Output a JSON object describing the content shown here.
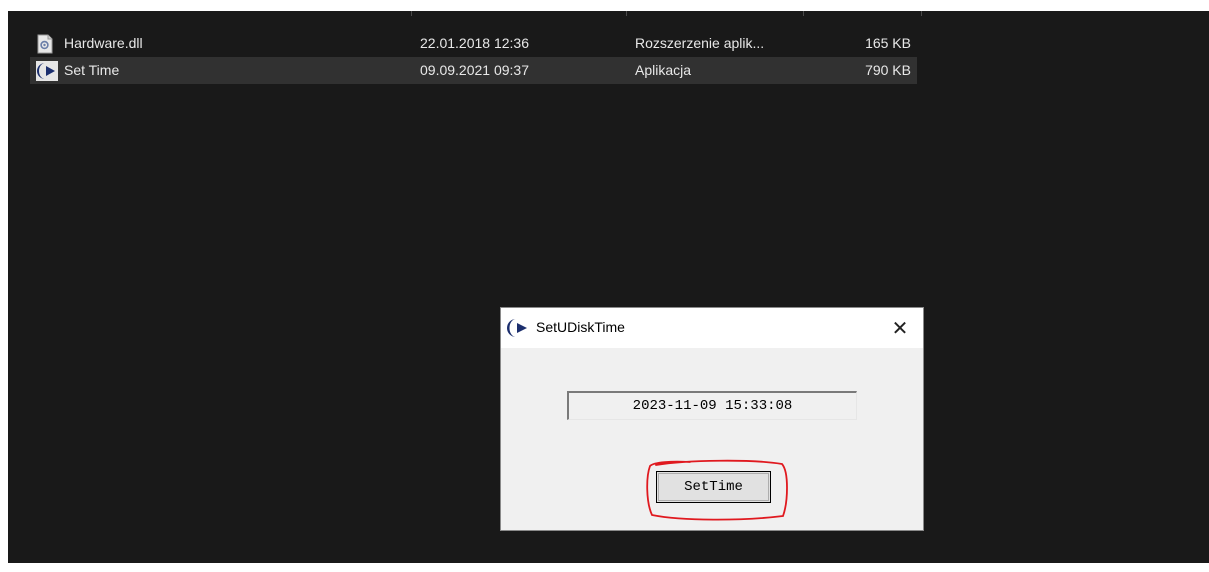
{
  "explorer": {
    "files": [
      {
        "name": "Hardware.dll",
        "modified": "22.01.2018 12:36",
        "type": "Rozszerzenie aplik...",
        "size": "165 KB",
        "icon": "dll-file-icon",
        "selected": false
      },
      {
        "name": "Set Time",
        "modified": "09.09.2021 09:37",
        "type": "Aplikacja",
        "size": "790 KB",
        "icon": "app-icon",
        "selected": true
      }
    ]
  },
  "dialog": {
    "title": "SetUDiskTime",
    "close_glyph": "✕",
    "time_value": "2023-11-09 15:33:08",
    "set_button_label": "SetTime"
  },
  "colors": {
    "explorer_bg": "#191919",
    "selected_row": "#313131",
    "dialog_bg": "#f0f0f0",
    "annotation": "#e0191f"
  }
}
